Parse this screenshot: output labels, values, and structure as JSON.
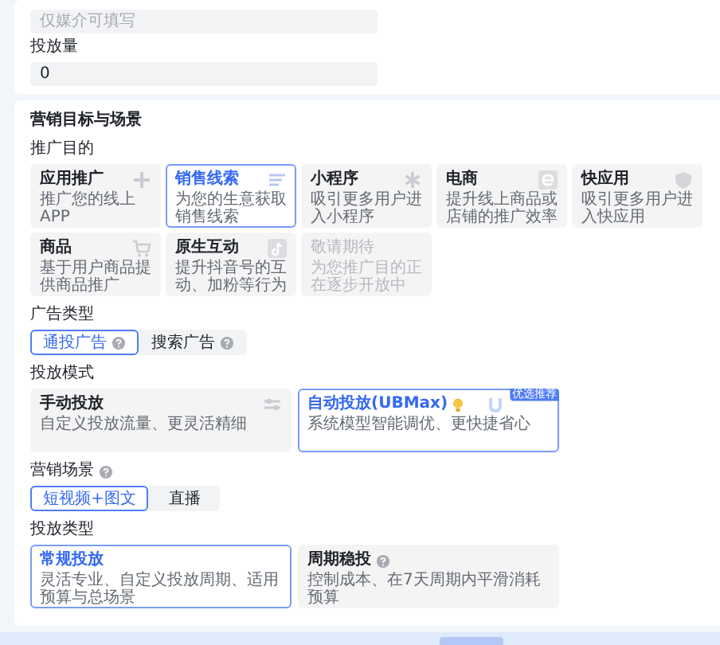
{
  "basic_fields": [
    {
      "placeholder": "仅媒介可填写"
    },
    {
      "label": "投放量",
      "value": "0"
    }
  ],
  "section": {
    "title": "营销目标与场景",
    "groups": [
      {
        "label": "推广目的",
        "kind": "cards",
        "items": [
          {
            "title": "应用推广",
            "description": "推广您的线上APP",
            "selected": false,
            "disabled": false
          },
          {
            "title": "销售线索",
            "description": "为您的生意获取销售线索",
            "selected": true,
            "disabled": false
          },
          {
            "title": "小程序",
            "description": "吸引更多用户进入小程序",
            "selected": false,
            "disabled": false
          },
          {
            "title": "电商",
            "description": "提升线上商品或店铺的推广效率",
            "selected": false,
            "disabled": false
          },
          {
            "title": "快应用",
            "description": "吸引更多用户进入快应用",
            "selected": false,
            "disabled": false
          },
          {
            "title": "商品",
            "description": "基于用户商品提供商品推广",
            "selected": false,
            "disabled": false
          },
          {
            "title": "原生互动",
            "description": "提升抖音号的互动、加粉等行为",
            "selected": false,
            "disabled": false
          },
          {
            "title": "敬请期待",
            "description": "为您推广目的正在逐步开放中",
            "selected": false,
            "disabled": true
          }
        ]
      },
      {
        "label": "广告类型",
        "kind": "segmented",
        "items": [
          {
            "title": "通投广告",
            "help": true,
            "selected": true
          },
          {
            "title": "搜索广告",
            "help": true,
            "selected": false
          }
        ]
      },
      {
        "label": "投放模式",
        "kind": "wide_cards",
        "items": [
          {
            "title": "手动投放",
            "description": "自定义投放流量、更灵活精细",
            "selected": false,
            "disabled": false
          },
          {
            "title": "自动投放(UBMax)",
            "tip": true,
            "badge": "优选推荐",
            "description": "系统模型智能调优、更快捷省心",
            "selected": true,
            "disabled": false
          }
        ]
      },
      {
        "label": "营销场景",
        "help": true,
        "kind": "segmented",
        "items": [
          {
            "title": "短视频+图文",
            "help": false,
            "selected": true
          },
          {
            "title": "直播",
            "help": false,
            "selected": false
          }
        ]
      },
      {
        "label": "投放类型",
        "kind": "wide_cards",
        "items": [
          {
            "title": "常规投放",
            "description": "灵活专业、自定义投放周期、适用预算与总场景",
            "selected": true,
            "disabled": false
          },
          {
            "title": "周期稳投",
            "help": true,
            "description": "控制成本、在7天周期内平滑消耗预算",
            "selected": false,
            "disabled": false
          }
        ]
      }
    ]
  }
}
